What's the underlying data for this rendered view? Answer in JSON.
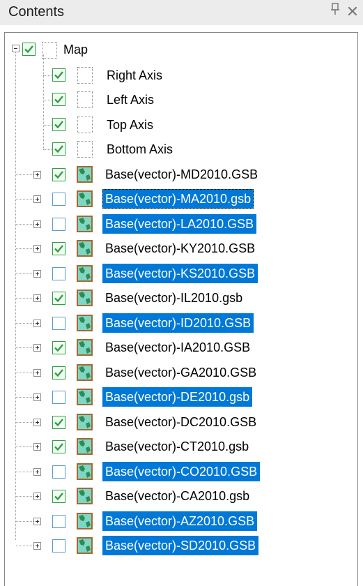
{
  "panel": {
    "title": "Contents",
    "pin_glyph": "ᴘ",
    "close_glyph": "✕"
  },
  "colors": {
    "selection": "#0078d7",
    "check": "#2f9e44",
    "layer_icon_border": "#a46830",
    "layer_icon_fill": "#7fd6c3"
  },
  "tree": {
    "root": {
      "label": "Map",
      "checked": true,
      "expanded": true
    },
    "axes": [
      {
        "label": "Right Axis",
        "checked": true
      },
      {
        "label": "Left Axis",
        "checked": true
      },
      {
        "label": "Top Axis",
        "checked": true
      },
      {
        "label": "Bottom Axis",
        "checked": true
      }
    ],
    "layers": [
      {
        "label": "Base(vector)-MD2010.GSB",
        "checked": true,
        "selected": false,
        "focused": false
      },
      {
        "label": "Base(vector)-MA2010.gsb",
        "checked": false,
        "selected": true,
        "focused": true
      },
      {
        "label": "Base(vector)-LA2010.GSB",
        "checked": false,
        "selected": true,
        "focused": false
      },
      {
        "label": "Base(vector)-KY2010.GSB",
        "checked": true,
        "selected": false,
        "focused": false
      },
      {
        "label": "Base(vector)-KS2010.GSB",
        "checked": false,
        "selected": true,
        "focused": false
      },
      {
        "label": "Base(vector)-IL2010.gsb",
        "checked": true,
        "selected": false,
        "focused": false
      },
      {
        "label": "Base(vector)-ID2010.GSB",
        "checked": false,
        "selected": true,
        "focused": false
      },
      {
        "label": "Base(vector)-IA2010.GSB",
        "checked": true,
        "selected": false,
        "focused": false
      },
      {
        "label": "Base(vector)-GA2010.GSB",
        "checked": true,
        "selected": false,
        "focused": false
      },
      {
        "label": "Base(vector)-DE2010.gsb",
        "checked": false,
        "selected": true,
        "focused": false
      },
      {
        "label": "Base(vector)-DC2010.GSB",
        "checked": true,
        "selected": false,
        "focused": false
      },
      {
        "label": "Base(vector)-CT2010.gsb",
        "checked": true,
        "selected": false,
        "focused": false
      },
      {
        "label": "Base(vector)-CO2010.GSB",
        "checked": false,
        "selected": true,
        "focused": false
      },
      {
        "label": "Base(vector)-CA2010.gsb",
        "checked": true,
        "selected": false,
        "focused": false
      },
      {
        "label": "Base(vector)-AZ2010.GSB",
        "checked": false,
        "selected": true,
        "focused": false
      },
      {
        "label": "Base(vector)-SD2010.GSB",
        "checked": false,
        "selected": true,
        "focused": false
      }
    ]
  }
}
